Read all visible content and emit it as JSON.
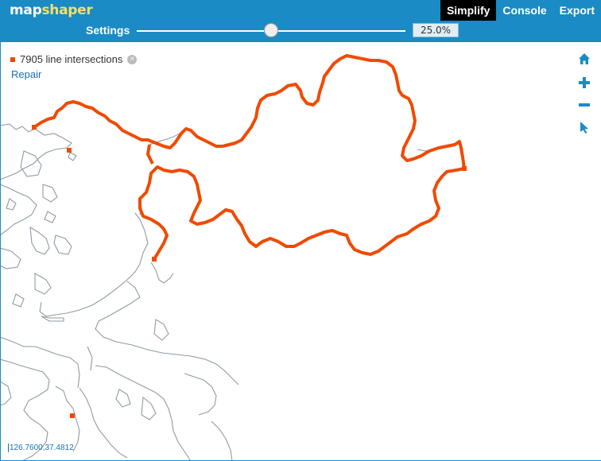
{
  "app": {
    "logo_part1": "map",
    "logo_part2": "shaper"
  },
  "nav": {
    "simplify": "Simplify",
    "console": "Console",
    "export": "Export"
  },
  "settings": {
    "label": "Settings",
    "slider_percent": 25,
    "value_text": "25.0%"
  },
  "intersections": {
    "text": "7905 line intersections",
    "close_glyph": "×",
    "repair_label": "Repair"
  },
  "tools": [
    "home-icon",
    "zoom-in-icon",
    "zoom-out-icon",
    "pointer-icon"
  ],
  "coordinates": "126.7600,37.4812",
  "colors": {
    "header": "#1a8bc5",
    "intersection": "#f04a00",
    "coast": "#8f9aa3",
    "link": "#1a6fb0"
  }
}
